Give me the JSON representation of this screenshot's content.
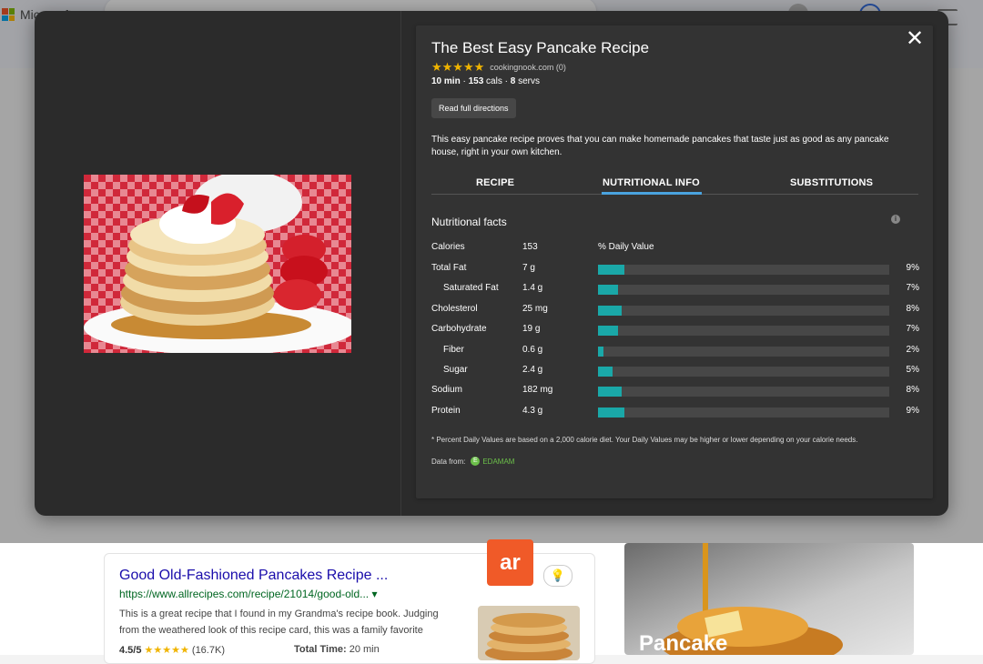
{
  "background": {
    "brand": "Microsoft",
    "result": {
      "title": "Good Old-Fashioned Pancakes Recipe ...",
      "url": "https://www.allrecipes.com/recipe/21014/good-old...",
      "url_arrow": "▾",
      "snippet": "This is a great recipe that I found in my Grandma's recipe book. Judging from the weathered look of this recipe card, this was a family favorite",
      "rating": "4.5/5",
      "stars": "★★★★★",
      "rating_count": "(16.7K)",
      "total_time_label": "Total Time:",
      "total_time_value": "20 min",
      "source_logo": "ar"
    },
    "side_card_label": "Pancake"
  },
  "recipe": {
    "title": "The Best Easy Pancake Recipe",
    "stars": "★★★★★",
    "source": "cookingnook.com (0)",
    "time": "10 min",
    "cals": "153",
    "cals_label": "cals",
    "servs": "8",
    "servs_label": "servs",
    "read_button": "Read full directions",
    "description": "This easy pancake recipe proves that you can make homemade pancakes that taste just as good as any pancake house, right in your own kitchen.",
    "close": "✕"
  },
  "tabs": [
    {
      "label": "RECIPE",
      "active": false
    },
    {
      "label": "NUTRITIONAL INFO",
      "active": true
    },
    {
      "label": "SUBSTITUTIONS",
      "active": false
    }
  ],
  "nutrition": {
    "heading": "Nutritional facts",
    "info_icon": "i",
    "dv_header": "% Daily Value",
    "calories_label": "Calories",
    "calories_value": "153",
    "rows": [
      {
        "name": "Total Fat",
        "amount": "7 g",
        "pct": "9%",
        "value": 9,
        "indent": false
      },
      {
        "name": "Saturated Fat",
        "amount": "1.4 g",
        "pct": "7%",
        "value": 7,
        "indent": true
      },
      {
        "name": "Cholesterol",
        "amount": "25 mg",
        "pct": "8%",
        "value": 8,
        "indent": false
      },
      {
        "name": "Carbohydrate",
        "amount": "19 g",
        "pct": "7%",
        "value": 7,
        "indent": false
      },
      {
        "name": "Fiber",
        "amount": "0.6 g",
        "pct": "2%",
        "value": 2,
        "indent": true
      },
      {
        "name": "Sugar",
        "amount": "2.4 g",
        "pct": "5%",
        "value": 5,
        "indent": true
      },
      {
        "name": "Sodium",
        "amount": "182 mg",
        "pct": "8%",
        "value": 8,
        "indent": false
      },
      {
        "name": "Protein",
        "amount": "4.3 g",
        "pct": "9%",
        "value": 9,
        "indent": false
      }
    ],
    "footnote": "* Percent Daily Values are based on a 2,000 calorie diet. Your Daily Values may be higher or lower depending on your calorie needs.",
    "data_from_label": "Data from:",
    "data_source": "EDAMAM",
    "data_source_icon": "E"
  },
  "colors": {
    "bar_fill": "#1aa8a8",
    "active_tab": "#4aa3df",
    "stars": "#f0b400"
  }
}
